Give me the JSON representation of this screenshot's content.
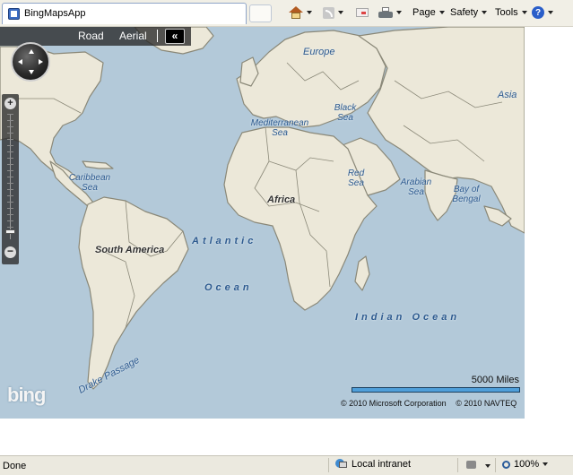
{
  "browser": {
    "tab_title": "BingMapsApp",
    "toolbar": {
      "page_label": "Page",
      "safety_label": "Safety",
      "tools_label": "Tools",
      "help_label": "?"
    }
  },
  "map": {
    "nav": {
      "road_label": "Road",
      "aerial_label": "Aerial",
      "collapse_label": "«"
    },
    "zoom": {
      "in_label": "+",
      "out_label": "−"
    },
    "labels": {
      "europe": "Europe",
      "asia": "Asia",
      "black_sea": "Black Sea",
      "mediterranean_sea": "Mediterranean Sea",
      "caribbean_sea": "Caribbean Sea",
      "red_sea": "Red Sea",
      "arabian_sea": "Arabian Sea",
      "bay_of_bengal": "Bay of Bengal",
      "africa": "Africa",
      "atlantic": "Atlantic",
      "ocean": "Ocean",
      "south_america": "South America",
      "indian_ocean": "Indian Ocean",
      "drake_passage": "Drake Passage"
    },
    "logo_text": "bing",
    "scale_text": "5000 Miles",
    "copyright_microsoft": "© 2010 Microsoft Corporation",
    "copyright_navteq": "© 2010 NAVTEQ"
  },
  "status": {
    "text": "Done",
    "zone": "Local intranet",
    "zoom": "100%"
  },
  "colors": {
    "water": "#b3c9d9",
    "land": "#ece8d9",
    "border": "#8a8878",
    "scale_bar": "#4f9fda"
  }
}
